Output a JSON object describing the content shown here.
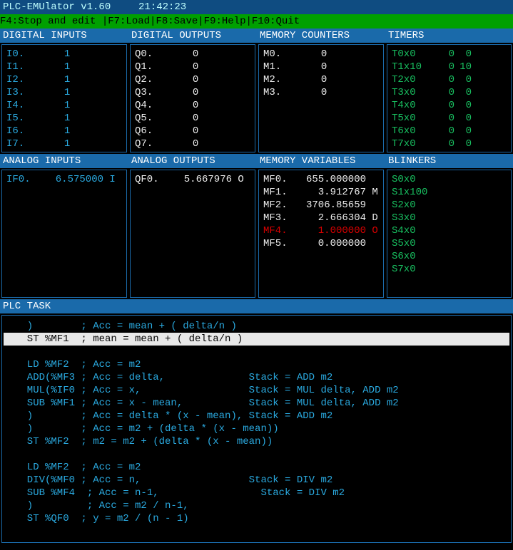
{
  "title": "PLC-EMUlator v1.60",
  "time": "21:42:23",
  "menu": {
    "f4": "F4:Stop and edit ",
    "f7": "|F7:Load",
    "f8": "|F8:Save",
    "f9": "|F9:Help",
    "f10": "|F10:Quit"
  },
  "headers": {
    "digital_inputs": "DIGITAL INPUTS",
    "digital_outputs": "DIGITAL OUTPUTS",
    "memory_counters": "MEMORY COUNTERS",
    "timers": "TIMERS",
    "analog_inputs": "ANALOG INPUTS",
    "analog_outputs": "ANALOG OUTPUTS",
    "memory_variables": "MEMORY VARIABLES",
    "blinkers": "BLINKERS",
    "plc_task": "PLC TASK"
  },
  "digital_inputs": [
    {
      "label": "I0.",
      "value": "1"
    },
    {
      "label": "I1.",
      "value": "1"
    },
    {
      "label": "I2.",
      "value": "1"
    },
    {
      "label": "I3.",
      "value": "1"
    },
    {
      "label": "I4.",
      "value": "1"
    },
    {
      "label": "I5.",
      "value": "1"
    },
    {
      "label": "I6.",
      "value": "1"
    },
    {
      "label": "I7.",
      "value": "1"
    }
  ],
  "digital_outputs": [
    {
      "label": "Q0.",
      "value": "0"
    },
    {
      "label": "Q1.",
      "value": "0"
    },
    {
      "label": "Q2.",
      "value": "0"
    },
    {
      "label": "Q3.",
      "value": "0"
    },
    {
      "label": "Q4.",
      "value": "0"
    },
    {
      "label": "Q5.",
      "value": "0"
    },
    {
      "label": "Q6.",
      "value": "0"
    },
    {
      "label": "Q7.",
      "value": "0"
    }
  ],
  "memory_counters": [
    {
      "label": "M0.",
      "value": "0"
    },
    {
      "label": "M1.",
      "value": "0"
    },
    {
      "label": "M2.",
      "value": "0"
    },
    {
      "label": "M3.",
      "value": "0"
    }
  ],
  "timers": [
    {
      "label": "T0x0",
      "v1": "0",
      "v2": "0"
    },
    {
      "label": "T1x10",
      "v1": "0",
      "v2": "10"
    },
    {
      "label": "T2x0",
      "v1": "0",
      "v2": "0"
    },
    {
      "label": "T3x0",
      "v1": "0",
      "v2": "0"
    },
    {
      "label": "T4x0",
      "v1": "0",
      "v2": "0"
    },
    {
      "label": "T5x0",
      "v1": "0",
      "v2": "0"
    },
    {
      "label": "T6x0",
      "v1": "0",
      "v2": "0"
    },
    {
      "label": "T7x0",
      "v1": "0",
      "v2": "0"
    }
  ],
  "analog_inputs": [
    {
      "label": "IF0.",
      "value": "6.575000",
      "flag": "I"
    }
  ],
  "analog_outputs": [
    {
      "label": "QF0.",
      "value": "5.667976",
      "flag": "O"
    }
  ],
  "memory_variables": [
    {
      "label": "MF0.",
      "value": "655.000000",
      "flag": " ",
      "error": false
    },
    {
      "label": "MF1.",
      "value": "3.912767",
      "flag": "M",
      "error": false
    },
    {
      "label": "MF2.",
      "value": "3706.85659",
      "flag": " ",
      "error": false
    },
    {
      "label": "MF3.",
      "value": "2.666304",
      "flag": "D",
      "error": false
    },
    {
      "label": "MF4.",
      "value": "1.000000",
      "flag": "O",
      "error": true
    },
    {
      "label": "MF5.",
      "value": "0.000000",
      "flag": " ",
      "error": false
    }
  ],
  "blinkers": [
    {
      "label": "S0x0"
    },
    {
      "label": "S1x100"
    },
    {
      "label": "S2x0"
    },
    {
      "label": "S3x0"
    },
    {
      "label": "S4x0"
    },
    {
      "label": "S5x0"
    },
    {
      "label": "S6x0"
    },
    {
      "label": "S7x0"
    }
  ],
  "code": [
    {
      "text": "  )        ; Acc = mean + ( delta/n )",
      "sel": false
    },
    {
      "text": "  ST %MF1  ; mean = mean + ( delta/n )",
      "sel": true
    },
    {
      "text": "",
      "sel": false
    },
    {
      "text": "  LD %MF2  ; Acc = m2",
      "sel": false
    },
    {
      "text": "  ADD(%MF3 ; Acc = delta,              Stack = ADD m2",
      "sel": false
    },
    {
      "text": "  MUL(%IF0 ; Acc = x,                  Stack = MUL delta, ADD m2",
      "sel": false
    },
    {
      "text": "  SUB %MF1 ; Acc = x - mean,           Stack = MUL delta, ADD m2",
      "sel": false
    },
    {
      "text": "  )        ; Acc = delta * (x - mean), Stack = ADD m2",
      "sel": false
    },
    {
      "text": "  )        ; Acc = m2 + (delta * (x - mean))",
      "sel": false
    },
    {
      "text": "  ST %MF2  ; m2 = m2 + (delta * (x - mean))",
      "sel": false
    },
    {
      "text": "",
      "sel": false
    },
    {
      "text": "  LD %MF2  ; Acc = m2",
      "sel": false
    },
    {
      "text": "  DIV(%MF0 ; Acc = n,                  Stack = DIV m2",
      "sel": false
    },
    {
      "text": "  SUB %MF4  ; Acc = n-1,                 Stack = DIV m2",
      "sel": false
    },
    {
      "text": "  )         ; Acc = m2 / n-1,",
      "sel": false
    },
    {
      "text": "  ST %QF0  ; y = m2 / (n - 1)",
      "sel": false
    }
  ]
}
